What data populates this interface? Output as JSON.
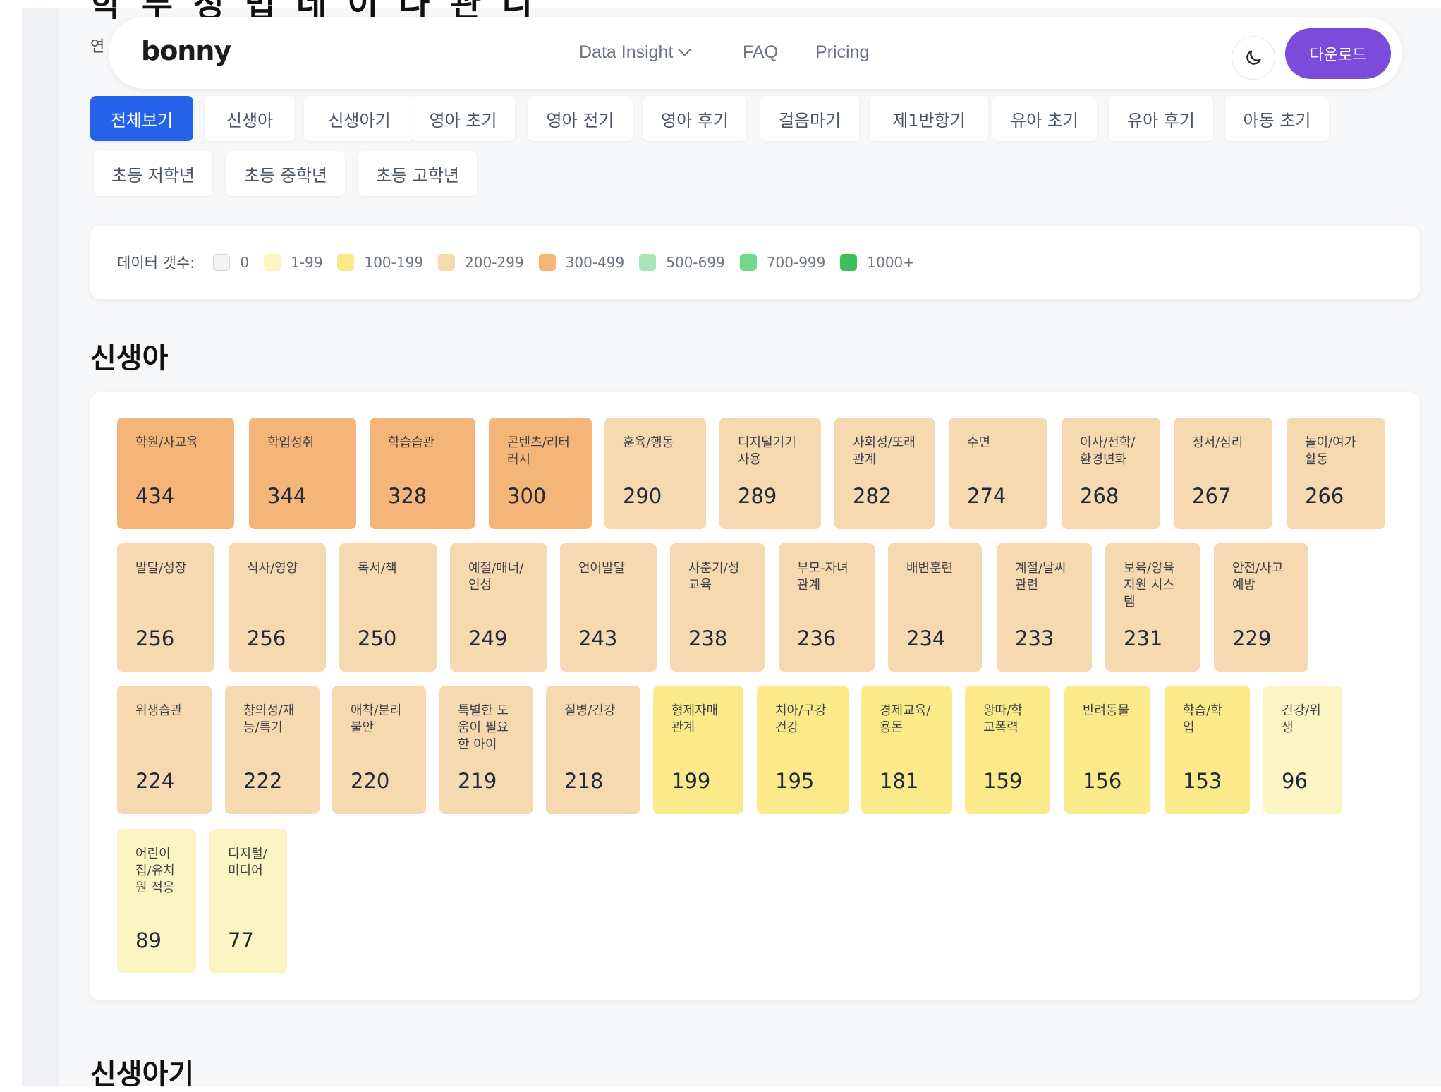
{
  "page_heading_partial": "학 부 정 법   네 이 나 관 니",
  "sub_label_partial": "연",
  "nav": {
    "logo": "bonny",
    "links": [
      "Data Insight",
      "FAQ",
      "Pricing"
    ],
    "download_label": "다운로드"
  },
  "tabs": [
    "전체보기",
    "신생아",
    "신생아기",
    "영아 초기",
    "영아 전기",
    "영아 후기",
    "걸음마기",
    "제1반항기",
    "유아 초기",
    "유아 후기",
    "아동 초기",
    "초등 저학년",
    "초등 중학년",
    "초등 고학년"
  ],
  "active_tab": "전체보기",
  "legend": {
    "title": "데이터 갯수:",
    "items": [
      {
        "label": "0",
        "color": "#f3f4f6"
      },
      {
        "label": "1-99",
        "color": "#fdf4c4"
      },
      {
        "label": "100-199",
        "color": "#fbe98a"
      },
      {
        "label": "200-299",
        "color": "#f6d9b0"
      },
      {
        "label": "300-499",
        "color": "#f5b578"
      },
      {
        "label": "500-699",
        "color": "#a8e6b8"
      },
      {
        "label": "700-999",
        "color": "#6fd98a"
      },
      {
        "label": "1000+",
        "color": "#3cbe5a"
      }
    ]
  },
  "section_title": "신생아",
  "next_section_title": "신생아기",
  "cards": [
    {
      "label": "학원/사교육",
      "value": "434",
      "color": "#f5b578"
    },
    {
      "label": "학업성취",
      "value": "344",
      "color": "#f5b578"
    },
    {
      "label": "학습습관",
      "value": "328",
      "color": "#f5b578"
    },
    {
      "label": "콘텐츠/리터러시",
      "value": "300",
      "color": "#f5b578"
    },
    {
      "label": "훈육/행동",
      "value": "290",
      "color": "#f6d9b0"
    },
    {
      "label": "디지털기기 사용",
      "value": "289",
      "color": "#f6d9b0"
    },
    {
      "label": "사회성/또래관계",
      "value": "282",
      "color": "#f6d9b0"
    },
    {
      "label": "수면",
      "value": "274",
      "color": "#f6d9b0"
    },
    {
      "label": "이사/전학/환경변화",
      "value": "268",
      "color": "#f6d9b0"
    },
    {
      "label": "정서/심리",
      "value": "267",
      "color": "#f6d9b0"
    },
    {
      "label": "놀이/여가활동",
      "value": "266",
      "color": "#f6d9b0"
    },
    {
      "label": "발달/성장",
      "value": "256",
      "color": "#f6d9b0"
    },
    {
      "label": "식사/영양",
      "value": "256",
      "color": "#f6d9b0"
    },
    {
      "label": "독서/책",
      "value": "250",
      "color": "#f6d9b0"
    },
    {
      "label": "예절/매너/인성",
      "value": "249",
      "color": "#f6d9b0"
    },
    {
      "label": "언어발달",
      "value": "243",
      "color": "#f6d9b0"
    },
    {
      "label": "사춘기/성교육",
      "value": "238",
      "color": "#f6d9b0"
    },
    {
      "label": "부모-자녀관계",
      "value": "236",
      "color": "#f6d9b0"
    },
    {
      "label": "배변훈련",
      "value": "234",
      "color": "#f6d9b0"
    },
    {
      "label": "계절/날씨관련",
      "value": "233",
      "color": "#f6d9b0"
    },
    {
      "label": "보육/양육지원 시스템",
      "value": "231",
      "color": "#f6d9b0"
    },
    {
      "label": "안전/사고예방",
      "value": "229",
      "color": "#f6d9b0"
    },
    {
      "label": "위생습관",
      "value": "224",
      "color": "#f6d9b0"
    },
    {
      "label": "창의성/재능/특기",
      "value": "222",
      "color": "#f6d9b0"
    },
    {
      "label": "애착/분리불안",
      "value": "220",
      "color": "#f6d9b0"
    },
    {
      "label": "특별한 도움이 필요한 아이",
      "value": "219",
      "color": "#f6d9b0"
    },
    {
      "label": "질병/건강",
      "value": "218",
      "color": "#f6d9b0"
    },
    {
      "label": "형제자매관계",
      "value": "199",
      "color": "#fbe98a"
    },
    {
      "label": "치아/구강건강",
      "value": "195",
      "color": "#fbe98a"
    },
    {
      "label": "경제교육/용돈",
      "value": "181",
      "color": "#fbe98a"
    },
    {
      "label": "왕따/학교폭력",
      "value": "159",
      "color": "#fbe98a"
    },
    {
      "label": "반려동물",
      "value": "156",
      "color": "#fbe98a"
    },
    {
      "label": "학습/학업",
      "value": "153",
      "color": "#fbe98a"
    },
    {
      "label": "건강/위생",
      "value": "96",
      "color": "#fdf4c4"
    },
    {
      "label": "어린이집/유치원 적응",
      "value": "89",
      "color": "#fdf4c4"
    },
    {
      "label": "디지털/미디어",
      "value": "77",
      "color": "#fdf4c4"
    }
  ]
}
